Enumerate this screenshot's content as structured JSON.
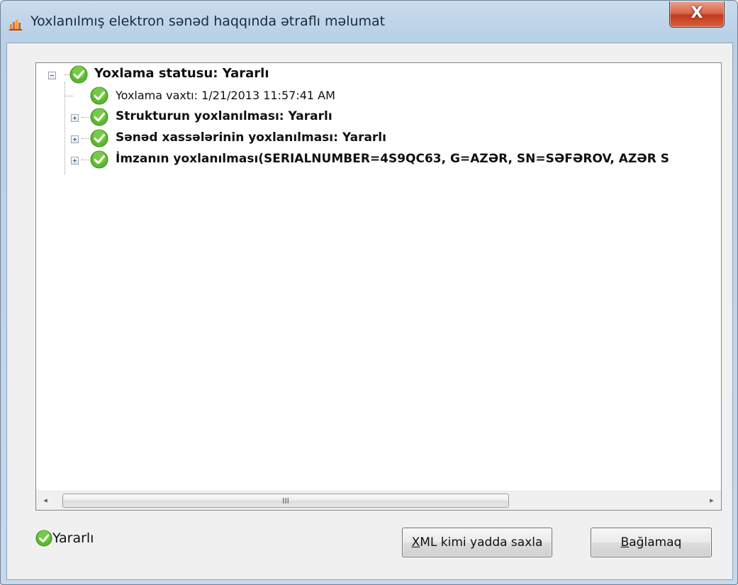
{
  "window": {
    "title": "Yoxlanılmış elektron sənəd haqqında ətraflı məlumat",
    "close_glyph": "X"
  },
  "tree": {
    "nodes": [
      {
        "label": "Yoxlama statusu: Yararlı",
        "bold": true,
        "expander": "minus",
        "icon": "check-circle-icon"
      },
      {
        "label": "Yoxlama vaxtı: 1/21/2013 11:57:41 AM",
        "bold": false,
        "expander": "none",
        "icon": "check-circle-icon"
      },
      {
        "label": "Strukturun yoxlanılması: Yararlı",
        "bold": true,
        "expander": "plus",
        "icon": "check-circle-icon"
      },
      {
        "label": "Sənəd xassələrinin yoxlanılması: Yararlı",
        "bold": true,
        "expander": "plus",
        "icon": "check-circle-icon"
      },
      {
        "label": "İmzanın yoxlanılması(SERIALNUMBER=4S9QC63, G=AZƏR, SN=SƏFƏROV, AZƏR S",
        "bold": true,
        "expander": "plus",
        "icon": "check-circle-icon"
      }
    ]
  },
  "scrollbar": {
    "left_arrow": "◂",
    "right_arrow": "▸",
    "grip": "III"
  },
  "status": {
    "label": "Yararlı",
    "icon": "check-circle-icon"
  },
  "buttons": {
    "xml_mnemonic": "X",
    "xml_rest": "ML kimi yadda saxla",
    "close_mnemonic": "B",
    "close_rest": "ağlamaq"
  },
  "colors": {
    "check_green": "#5cb82e",
    "close_button": "#c9462a"
  }
}
